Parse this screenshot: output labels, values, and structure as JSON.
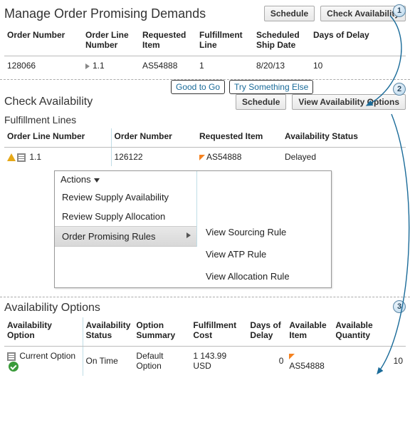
{
  "section1": {
    "title": "Manage Order Promising Demands",
    "buttons": {
      "schedule": "Schedule",
      "check": "Check Availability"
    },
    "cols": [
      "Order Number",
      "Order Line Number",
      "Requested Item",
      "Fulfillment Line",
      "Scheduled Ship Date",
      "Days of Delay"
    ],
    "row": {
      "orderNum": "128066",
      "lineNum": "1.1",
      "item": "AS54888",
      "fline": "1",
      "shipDate": "8/20/13",
      "delay": "10"
    }
  },
  "tags": {
    "good": "Good to Go",
    "try": "Try Something Else"
  },
  "section2": {
    "title": "Check Availability",
    "subTitle": "Fulfillment Lines",
    "buttons": {
      "schedule": "Schedule",
      "view": "View Availability Options"
    },
    "cols": [
      "Order Line Number",
      "Order Number",
      "Requested Item",
      "Availability Status"
    ],
    "row": {
      "lineNum": "1.1",
      "orderNum": "126122",
      "item": "AS54888",
      "status": "Delayed"
    },
    "menu": {
      "header": "Actions",
      "items": [
        "Review Supply Availability",
        "Review Supply Allocation",
        "Order Promising Rules"
      ],
      "submenu": [
        "View Sourcing Rule",
        "View ATP Rule",
        "View Allocation Rule"
      ]
    }
  },
  "section3": {
    "title": "Availability Options",
    "cols": [
      "Availability Option",
      "Availability Status",
      "Option Summary",
      "Fulfillment Cost",
      "Days of Delay",
      "Available Item",
      "Available Quantity"
    ],
    "row": {
      "opt": "Current Option",
      "status": "On Time",
      "summary": "Default Option",
      "cost": "1 143.99 USD",
      "delay": "0",
      "item": "AS54888",
      "qty": "10"
    }
  },
  "badges": {
    "b1": "1",
    "b2": "2",
    "b3": "3"
  }
}
